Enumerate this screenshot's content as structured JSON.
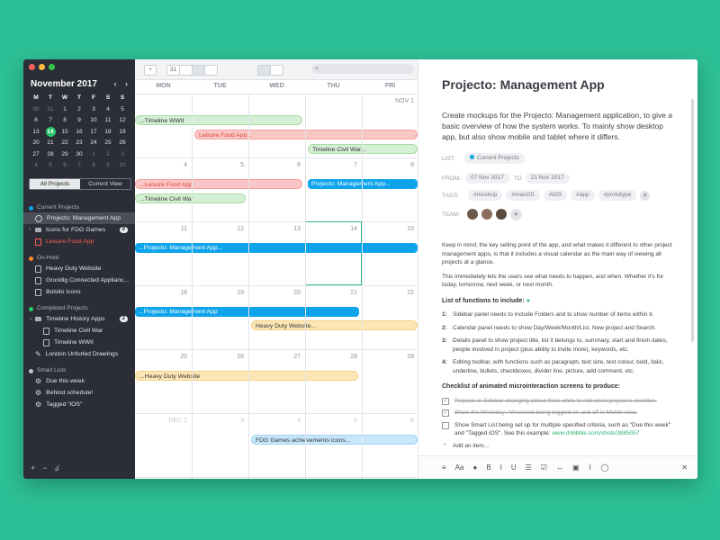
{
  "sidebar": {
    "month_title": "November 2017",
    "prev_arrow": "‹",
    "next_arrow": "›",
    "dow": [
      "M",
      "T",
      "W",
      "T",
      "F",
      "S",
      "S"
    ],
    "weeks": [
      [
        {
          "d": "30",
          "m": true
        },
        {
          "d": "31",
          "m": true
        },
        {
          "d": "1"
        },
        {
          "d": "2"
        },
        {
          "d": "3"
        },
        {
          "d": "4"
        },
        {
          "d": "5"
        }
      ],
      [
        {
          "d": "6"
        },
        {
          "d": "7"
        },
        {
          "d": "8"
        },
        {
          "d": "9"
        },
        {
          "d": "10"
        },
        {
          "d": "11"
        },
        {
          "d": "12"
        }
      ],
      [
        {
          "d": "13"
        },
        {
          "d": "14",
          "today": true
        },
        {
          "d": "15"
        },
        {
          "d": "16"
        },
        {
          "d": "17"
        },
        {
          "d": "18"
        },
        {
          "d": "19"
        }
      ],
      [
        {
          "d": "20"
        },
        {
          "d": "21"
        },
        {
          "d": "22"
        },
        {
          "d": "23"
        },
        {
          "d": "24"
        },
        {
          "d": "25"
        },
        {
          "d": "26"
        }
      ],
      [
        {
          "d": "27"
        },
        {
          "d": "28"
        },
        {
          "d": "29"
        },
        {
          "d": "30"
        },
        {
          "d": "1",
          "m": true
        },
        {
          "d": "2",
          "m": true
        },
        {
          "d": "3",
          "m": true
        }
      ],
      [
        {
          "d": "4",
          "m": true
        },
        {
          "d": "5",
          "m": true
        },
        {
          "d": "6",
          "m": true
        },
        {
          "d": "7",
          "m": true
        },
        {
          "d": "8",
          "m": true
        },
        {
          "d": "9",
          "m": true
        },
        {
          "d": "10",
          "m": true
        }
      ]
    ],
    "tab_all": "All Projects",
    "tab_current": "Current View",
    "groups": {
      "current": "Current Projects",
      "onhold": "On-Hold",
      "completed": "Completed Projects",
      "smart": "Smart Lists"
    },
    "current_items": {
      "projecto": "Projecto: Management App",
      "icons": "Icons for FDG Games",
      "icons_count": "9",
      "leisure": "Leisure Food App"
    },
    "onhold_items": {
      "heavy": "Heavy Duty Website",
      "grundig": "Grundig Connected Applianc...",
      "bolsito": "Bolsito Icons"
    },
    "completed_items": {
      "timeline": "Timeline History Apps",
      "timeline_count": "2",
      "civil": "Timeline Civil War",
      "wwii": "Timeline WWII",
      "london": "London Unfurled Drawings"
    },
    "smart_items": {
      "due": "Due this week",
      "behind": "Behind schedule!",
      "tagged": "Tagged “iOS”"
    },
    "footer": {
      "add": "+",
      "remove": "−",
      "settings": "⫝̸"
    }
  },
  "toolbar": {
    "add": "+",
    "day": "31",
    "search_icon": "⌕"
  },
  "calendar": {
    "dow": [
      "MON",
      "TUE",
      "WED",
      "THU",
      "FRI"
    ],
    "weeks": [
      {
        "days": [
          "",
          "",
          "",
          "",
          "NOV 1"
        ],
        "muted": [
          false,
          false,
          false,
          false,
          false
        ]
      },
      {
        "days": [
          "4",
          "5",
          "6",
          "7",
          "8"
        ],
        "muted": [
          false,
          false,
          false,
          false,
          false
        ]
      },
      {
        "days": [
          "11",
          "12",
          "13",
          "14",
          "15"
        ],
        "muted": [
          false,
          false,
          false,
          false,
          false
        ]
      },
      {
        "days": [
          "18",
          "19",
          "20",
          "21",
          "22"
        ],
        "muted": [
          false,
          false,
          false,
          false,
          false
        ]
      },
      {
        "days": [
          "25",
          "26",
          "27",
          "28",
          "29"
        ],
        "muted": [
          false,
          false,
          false,
          false,
          false
        ]
      },
      {
        "days": [
          "DEC 2",
          "3",
          "4",
          "5",
          "6"
        ],
        "muted": [
          true,
          true,
          true,
          true,
          true
        ]
      }
    ],
    "events": {
      "e1": "...Timeline WWII",
      "e2": "Leisure Food App...",
      "e3": "Timeline Civil War...",
      "e4": "...Leisure Food App",
      "e5": "Projecto: Management App...",
      "e6": "...Timeline Civil War",
      "e7": "...Projecto: Management App...",
      "e8": "...Projecto: Management App",
      "e9": "Heavy Duty Website...",
      "e10": "...Heavy Duty Website",
      "e11": "FDG Games achievements icons..."
    }
  },
  "detail": {
    "title": "Projecto: Management App",
    "description": "Create mockups for the Projecto: Management application, to give a basic overview of how the system works. To mainly show desktop app, but also show mobile and tablet where it differs.",
    "list_label": "LIST:",
    "list_value": "Current Projects",
    "from_label": "FROM:",
    "from_value": "07 Nov 2017",
    "to_label": "TO",
    "to_value": "21 Nov 2017",
    "tags_label": "TAGS:",
    "tags": [
      "#mockup",
      "#macOS",
      "#iOS",
      "#app",
      "#prototype"
    ],
    "team_label": "TEAM:",
    "para1": "Keep in mind, the key selling point of the app, and what makes it different to other project management apps, is that it includes a visual calendar as the main way of viewing all projects at a glance.",
    "para2": "This immediately lets the users see what needs to happen, and when. Whether it's for today, tomorrow, next week, or next month.",
    "functions_title": "List of functions to include:",
    "functions": [
      {
        "n": "1:",
        "t": "Sidebar panel needs to include Folders and to show number of items within it."
      },
      {
        "n": "2:",
        "t": "Calendar panel needs to show Day/Week/Month/List, New project and Search."
      },
      {
        "n": "3:",
        "t": "Details panel to show project title, list it belongs to, summary, start and finish dates, people involved in project (plus ability to invite more), keywords, etc."
      },
      {
        "n": "4:",
        "t": "Editing toolbar, with functions such as paragraph, text size, text colour, bold, italic, underline, bullets, checkboxes, divider line, picture, add comment, etc."
      }
    ],
    "checklist_title": "Checklist of animated microinteraction screens to produce:",
    "checklist": {
      "c1": "Projects in Sidebar changing colour from white to red when project is overdue.",
      "c2": "Show the Weekday / Weekend being toggled on and off in Month view.",
      "c3": "Show Smart List being set up for multiple specified criteria, such as \"Due this week\" and \"Tagged iOS\". See this example:",
      "c3_link": "www.dribbble.com/shots/3885057",
      "add": "Add an item..."
    },
    "footer_icons": [
      "≡",
      "Aa",
      "●",
      "B",
      "I",
      "U",
      "☰",
      "☑",
      "↔",
      "▣",
      "⌇",
      "◯",
      "✕"
    ]
  },
  "colors": {
    "accent_green": "#27c76a",
    "blue_event": "#0ea4ec",
    "background": "#2dbf95"
  }
}
